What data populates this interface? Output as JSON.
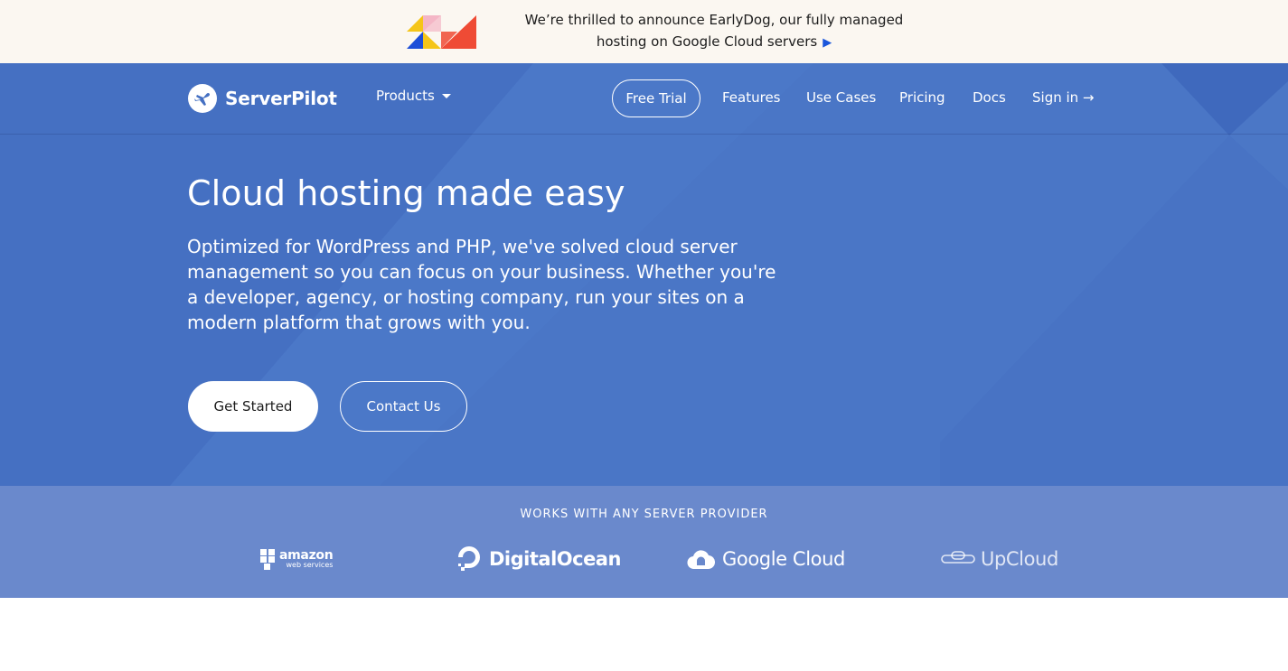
{
  "announcement": {
    "line1": "We’re thrilled to announce EarlyDog, our fully managed",
    "line2": "hosting on Google Cloud servers",
    "arrow": "▶",
    "logo_icon": "earlydog-triangles-logo",
    "colors": {
      "yellow": "#f5c518",
      "pink": "#f4b6c6",
      "blue": "#1d4ed8",
      "red": "#ef4b35"
    }
  },
  "nav": {
    "brand_name": "ServerPilot",
    "brand_icon": "plane-logo-icon",
    "products_label": "Products",
    "free_trial_label": "Free Trial",
    "links": {
      "features": "Features",
      "use_cases": "Use Cases",
      "pricing": "Pricing",
      "docs": "Docs",
      "sign_in": "Sign in →"
    }
  },
  "hero": {
    "title": "Cloud hosting made easy",
    "subtitle": "Optimized for WordPress and PHP, we've solved cloud server management so you can focus on your business. Whether you're a developer, agency, or hosting company, run your sites on a modern platform that grows with you.",
    "get_started_label": "Get Started",
    "contact_label": "Contact Us",
    "bg_color": "#4570c2"
  },
  "providers": {
    "title": "WORKS WITH ANY SERVER PROVIDER",
    "amazon": {
      "main": "amazon",
      "small": "web services"
    },
    "digitalocean": "DigitalOcean",
    "google": "Google Cloud",
    "upcloud": "UpCloud",
    "bg_color": "#6a89cc"
  }
}
